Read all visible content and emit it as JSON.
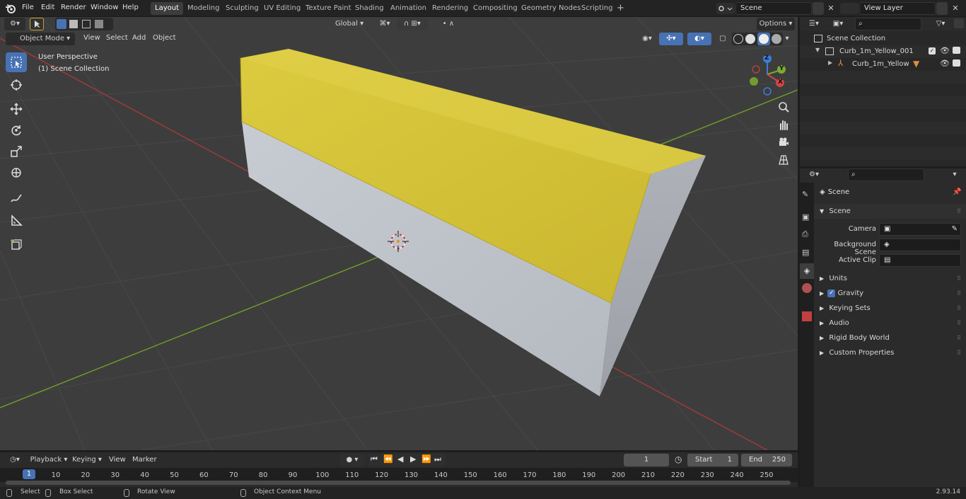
{
  "app": {
    "name": "Blender",
    "version": "2.93.14"
  },
  "topbar": {
    "menus": [
      "File",
      "Edit",
      "Render",
      "Window",
      "Help"
    ],
    "workspace_tabs": [
      "Layout",
      "Modeling",
      "Sculpting",
      "UV Editing",
      "Texture Paint",
      "Shading",
      "Animation",
      "Rendering",
      "Compositing",
      "Geometry Nodes",
      "Scripting"
    ],
    "active_tab": "Layout",
    "add_tab": "+",
    "scene_name": "Scene",
    "view_layer": "View Layer"
  },
  "viewport_header": {
    "mode": "Object Mode",
    "menus": [
      "View",
      "Select",
      "Add",
      "Object"
    ],
    "transform_orientation": "Global",
    "options_label": "Options"
  },
  "viewport": {
    "overlay_title": "User Perspective",
    "overlay_collection": "(1) Scene Collection",
    "gizmo_axes": {
      "x": "X",
      "y": "Y",
      "z": "Z"
    },
    "colors": {
      "curb_top": "#d4c23c",
      "curb_side": "#c3c7ce",
      "grid_bg": "#3d3d3d",
      "x_axis": "#a33a3a",
      "y_axis": "#6e9a28"
    }
  },
  "toolbar_tools": [
    "select-box",
    "cursor",
    "move",
    "rotate",
    "scale",
    "transform",
    "annotate",
    "measure",
    "add-cube"
  ],
  "outliner": {
    "root": "Scene Collection",
    "items": [
      {
        "name": "Curb_1m_Yellow_001",
        "type": "collection"
      },
      {
        "name": "Curb_1m_Yellow",
        "type": "object"
      }
    ]
  },
  "properties": {
    "context": "Scene",
    "section": "Scene",
    "fields": [
      {
        "label": "Camera",
        "value": ""
      },
      {
        "label": "Background Scene",
        "value": ""
      },
      {
        "label": "Active Clip",
        "value": ""
      }
    ],
    "panels": [
      "Units",
      "Gravity",
      "Keying Sets",
      "Audio",
      "Rigid Body World",
      "Custom Properties"
    ]
  },
  "timeline": {
    "menus": [
      "Playback",
      "Keying",
      "View",
      "Marker"
    ],
    "current_frame": "1",
    "start_label": "Start",
    "start_value": "1",
    "end_label": "End",
    "end_value": "250",
    "ticks": [
      "1",
      "10",
      "20",
      "30",
      "40",
      "50",
      "60",
      "70",
      "80",
      "90",
      "100",
      "110",
      "120",
      "130",
      "140",
      "150",
      "160",
      "170",
      "180",
      "190",
      "200",
      "210",
      "220",
      "230",
      "240",
      "250"
    ]
  },
  "statusbar": {
    "items": [
      "Select",
      "Box Select",
      "Rotate View",
      "Object Context Menu"
    ],
    "version": "2.93.14"
  }
}
